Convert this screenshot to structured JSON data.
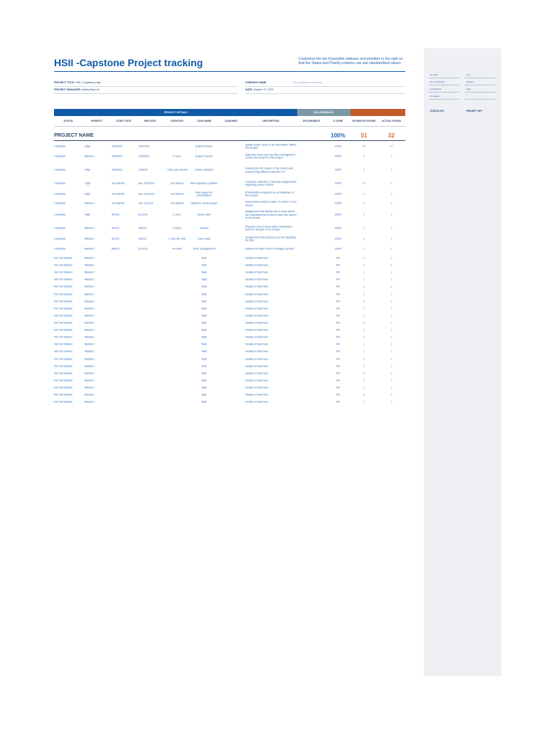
{
  "document": {
    "title": "HSII -Capstone Project tracking",
    "note": "Customize the list of possible statuses and priorities to the right so that the Status and Priority columns can use standardized values",
    "project_title_label": "PROJECT TITLE:",
    "project_title": "HSII 1 Capstone proje",
    "project_manager_label": "PROJECT MANAGER:",
    "project_manager": "Ashley Barco M",
    "company_name_label": "COMPANY NAME",
    "company_name": "City of Medicine Academy",
    "date_label": "DATE:",
    "date": "October 27, 2023"
  },
  "bands": {
    "project_details": "PROJECT DETAILS",
    "deliverables": "DELIVERABLES"
  },
  "headers": [
    "STATUS",
    "PRIORITY",
    "START DATE",
    "END DATE",
    "DURATION",
    "TASK NAME",
    "ASSIGNEE",
    "DESCRIPTION",
    "DELIVERABLE",
    "% DONE",
    "ESTIMATED HOURS",
    "ACTUAL HOURS"
  ],
  "summary": {
    "label": "PROJECT NAME",
    "percent": "100%",
    "estimated": "51",
    "actual": "32"
  },
  "rows": [
    {
      "status": "Complete",
      "priority": "High",
      "start": "10/15/23",
      "end": "10/22/23",
      "duration": "",
      "task": "project charter",
      "description": "details what I need to do and deliver within this project",
      "done": "100%",
      "est": "20",
      "act": "20"
    },
    {
      "status": "Complete",
      "priority": "Medium",
      "start": "10/08/23",
      "end": "10/09/23",
      "duration": "1 hour",
      "task": "project tracker",
      "description": "helps the team how my time management comes into play into this project",
      "done": "100%",
      "est": "4",
      "act": "3"
    },
    {
      "status": "Complete",
      "priority": "High",
      "start": "10/08/23",
      "end": "11/8/23",
      "duration": "1 hour per section",
      "task": "career research",
      "description": "looking into the career of my choice and researching different aspects of it",
      "done": "100%",
      "est": "5",
      "act": "3"
    },
    {
      "status": "Complete",
      "priority": "High",
      "start": "not started",
      "end": "due 11/30/23",
      "duration": "not started",
      "task": "final capstone portfolio",
      "description": "complete collection of all past assignments regarding career choice",
      "done": "100%",
      "est": "20",
      "act": "2"
    },
    {
      "status": "Complete",
      "priority": "High",
      "start": "not started",
      "end": "due 11/29/23",
      "duration": "not started",
      "task": "final capstone presentation",
      "description": "Presentation prepared on all materials of the project",
      "done": "100%",
      "est": "2",
      "act": "2"
    },
    {
      "status": "Complete",
      "priority": "Medium",
      "start": "not started",
      "end": "due 12/1/23",
      "duration": "not started",
      "task": "capstone career paper",
      "description": "researched analysis paper on career of my choice",
      "done": "100%",
      "est": "2",
      "act": "2"
    },
    {
      "status": "Complete",
      "priority": "High",
      "start": "9/4/23",
      "end": "8/11/23",
      "duration": "1 hour",
      "task": "career plan",
      "description": "Assignment that allows me to learn about the requirements for me to have the career of my choice",
      "done": "100%",
      "est": "2",
      "act": "2"
    },
    {
      "status": "Complete",
      "priority": "Medium",
      "start": "9/2/23",
      "end": "9/5/23",
      "duration": "2 hours",
      "task": "resume",
      "description": "Prepared me to know what credentials I have for the job of my choice",
      "done": "100%",
      "est": "2",
      "act": "2"
    },
    {
      "status": "Complete",
      "priority": "Medium",
      "start": "9/1/23",
      "end": "9/5/23",
      "duration": "1 hour 30 mins",
      "task": "cover letter",
      "description": "assignment that prepares you for applying for jobs",
      "done": "100%",
      "est": "2",
      "act": "2"
    },
    {
      "status": "Complete",
      "priority": "Medium",
      "start": "8/9/23",
      "end": "8/11/23",
      "duration": "40 mins",
      "task": "Time management",
      "description": "helped me learn how to manage my time",
      "done": "100%",
      "est": "2",
      "act": "2"
    },
    {
      "status": "Not Yet Started",
      "priority": "Medium",
      "start": "",
      "end": "",
      "duration": "",
      "task": "Task",
      "description": "Details of task here",
      "done": "0%",
      "est": "2",
      "act": "2"
    },
    {
      "status": "Not Yet Started",
      "priority": "Medium",
      "start": "",
      "end": "",
      "duration": "",
      "task": "Task",
      "description": "Details of task here",
      "done": "0%",
      "est": "2",
      "act": "2"
    },
    {
      "status": "Not Yet Started",
      "priority": "Medium",
      "start": "",
      "end": "",
      "duration": "",
      "task": "Task",
      "description": "Details of task here",
      "done": "0%",
      "est": "2",
      "act": "2"
    },
    {
      "status": "Not Yet Started",
      "priority": "Medium",
      "start": "",
      "end": "",
      "duration": "",
      "task": "Task",
      "description": "Details of task here",
      "done": "0%",
      "est": "2",
      "act": "2"
    },
    {
      "status": "Not Yet Started",
      "priority": "Medium",
      "start": "",
      "end": "",
      "duration": "",
      "task": "Task",
      "description": "Details of task here",
      "done": "0%",
      "est": "2",
      "act": "2"
    },
    {
      "status": "Not Yet Started",
      "priority": "Medium",
      "start": "",
      "end": "",
      "duration": "",
      "task": "Task",
      "description": "Details of task here",
      "done": "0%",
      "est": "2",
      "act": "2"
    },
    {
      "status": "Not Yet Started",
      "priority": "Medium",
      "start": "",
      "end": "",
      "duration": "",
      "task": "Task",
      "description": "Details of task here",
      "done": "0%",
      "est": "2",
      "act": "2"
    },
    {
      "status": "Not Yet Started",
      "priority": "Medium",
      "start": "",
      "end": "",
      "duration": "",
      "task": "Task",
      "description": "Details of task here",
      "done": "0%",
      "est": "2",
      "act": "2"
    },
    {
      "status": "Not Yet Started",
      "priority": "Medium",
      "start": "",
      "end": "",
      "duration": "",
      "task": "Task",
      "description": "Details of task here",
      "done": "0%",
      "est": "2",
      "act": "2"
    },
    {
      "status": "Not Yet Started",
      "priority": "Medium",
      "start": "",
      "end": "",
      "duration": "",
      "task": "Task",
      "description": "Details of task here",
      "done": "0%",
      "est": "2",
      "act": "2"
    },
    {
      "status": "Not Yet Started",
      "priority": "Medium",
      "start": "",
      "end": "",
      "duration": "",
      "task": "Task",
      "description": "Details of task here",
      "done": "0%",
      "est": "2",
      "act": "2"
    },
    {
      "status": "Not Yet Started",
      "priority": "Medium",
      "start": "",
      "end": "",
      "duration": "",
      "task": "Task",
      "description": "Details of task here",
      "done": "0%",
      "est": "2",
      "act": "2"
    },
    {
      "status": "Not Yet Started",
      "priority": "Medium",
      "start": "",
      "end": "",
      "duration": "",
      "task": "Task",
      "description": "Details of task here",
      "done": "0%",
      "est": "2",
      "act": "2"
    },
    {
      "status": "Not Yet Started",
      "priority": "Medium",
      "start": "",
      "end": "",
      "duration": "",
      "task": "Task",
      "description": "Details of task here",
      "done": "0%",
      "est": "2",
      "act": "2"
    },
    {
      "status": "Not Yet Started",
      "priority": "Medium",
      "start": "",
      "end": "",
      "duration": "",
      "task": "Task",
      "description": "Details of task here",
      "done": "0%",
      "est": "2",
      "act": "2"
    },
    {
      "status": "Not Yet Started",
      "priority": "Medium",
      "start": "",
      "end": "",
      "duration": "",
      "task": "Task",
      "description": "Details of task here",
      "done": "0%",
      "est": "2",
      "act": "2"
    },
    {
      "status": "Not Yet Started",
      "priority": "Medium",
      "start": "",
      "end": "",
      "duration": "",
      "task": "Task",
      "description": "Details of task here",
      "done": "0%",
      "est": "2",
      "act": "2"
    },
    {
      "status": "Not Yet Started",
      "priority": "Medium",
      "start": "",
      "end": "",
      "duration": "",
      "task": "Task",
      "description": "Details of task here",
      "done": "0%",
      "est": "2",
      "act": "2"
    },
    {
      "status": "Not Yet Started",
      "priority": "Medium",
      "start": "",
      "end": "",
      "duration": "",
      "task": "Task",
      "description": "Details of task here",
      "done": "0%",
      "est": "2",
      "act": "2"
    },
    {
      "status": "Not Yet Started",
      "priority": "Medium",
      "start": "",
      "end": "",
      "duration": "",
      "task": "Task",
      "description": "Details of task here",
      "done": "0%",
      "est": "2",
      "act": "2"
    },
    {
      "status": "Not Yet Started",
      "priority": "Medium",
      "start": "",
      "end": "",
      "duration": "",
      "task": "Task",
      "description": "Details of task here",
      "done": "0%",
      "est": "2",
      "act": "2"
    }
  ],
  "side_panel": {
    "status_header": "STATUS KEY",
    "priority_header": "PRIORITY KEY",
    "statuses": [
      "On Hold",
      "Not Yet Started",
      "In Progress",
      "Complete"
    ],
    "priorities": [
      "Low",
      "Medium",
      "High"
    ]
  },
  "colors": {
    "title_blue": "#0f5aa6",
    "band_project_details": "#0f5aa6",
    "band_deliverables": "#7a9aa6",
    "band_hours": "#c25a28",
    "orange_text": "#e2662a",
    "side_panel_bg": "#eef0f4"
  }
}
